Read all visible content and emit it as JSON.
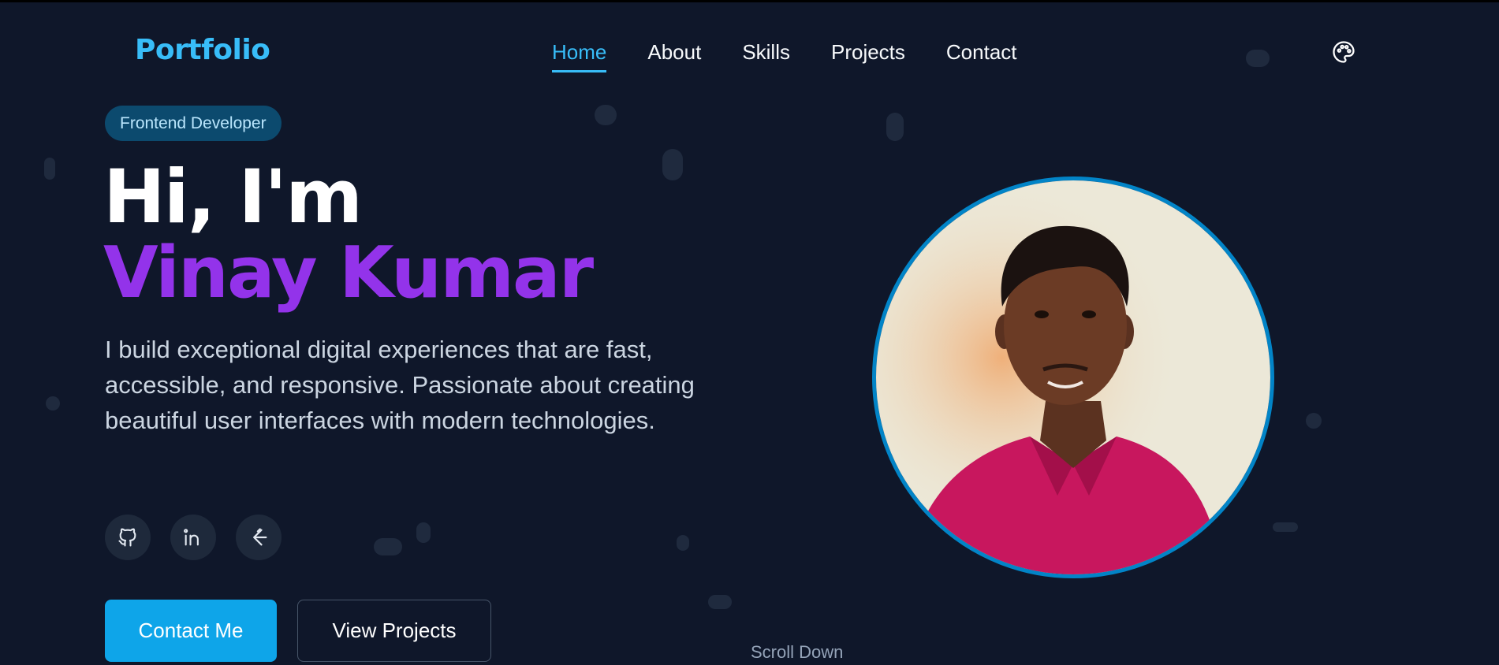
{
  "nav": {
    "logo": "Portfolio",
    "links": [
      "Home",
      "About",
      "Skills",
      "Projects",
      "Contact"
    ],
    "active": "Home",
    "theme_icon": "palette-icon"
  },
  "hero": {
    "badge": "Frontend Developer",
    "greeting": "Hi, I'm",
    "name": "Vinay Kumar",
    "description": "I build exceptional digital experiences that are fast, accessible, and responsive. Passionate about creating beautiful user interfaces with modern technologies.",
    "socials": [
      {
        "icon": "github-icon"
      },
      {
        "icon": "linkedin-icon"
      },
      {
        "icon": "leetcode-icon"
      }
    ],
    "primary_cta": "Contact Me",
    "secondary_cta": "View Projects",
    "scroll_hint": "Scroll Down"
  },
  "colors": {
    "background": "#0f172a",
    "accent": "#38bdf8",
    "name": "#9333ea",
    "badge_bg": "#0c4a6e",
    "primary_button": "#0ea5e9",
    "portrait_ring": "#0284c7"
  }
}
